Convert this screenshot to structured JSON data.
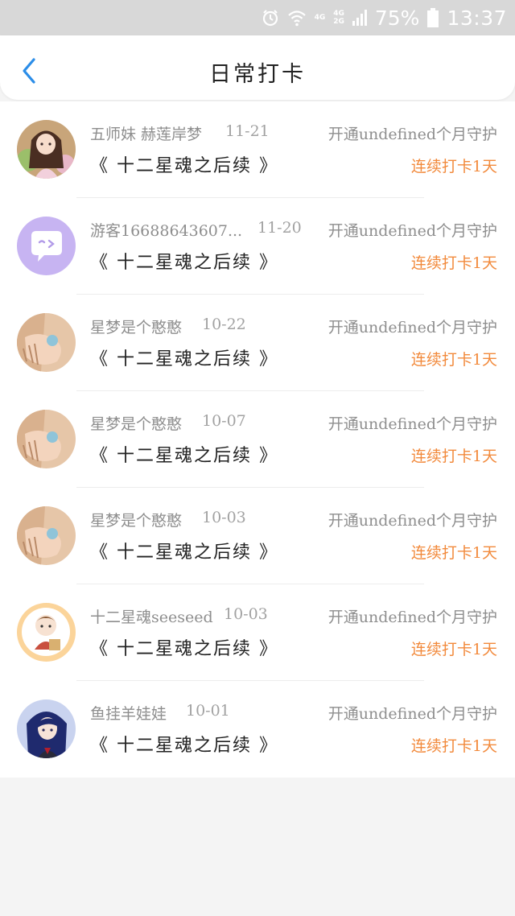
{
  "status_bar": {
    "network_top": "4G",
    "network_dual_top": "4G",
    "network_dual_bottom": "2G",
    "battery_percent": "75%",
    "time": "13:37"
  },
  "header": {
    "title": "日常打卡",
    "back_icon": "chevron-left-icon"
  },
  "colors": {
    "accent_blue": "#2b8de8",
    "streak_orange": "#f28a3c",
    "muted_text": "#8e8e8e"
  },
  "checkins": [
    {
      "username": "五师妹 赫莲岸梦",
      "date": "11-21",
      "book": "《 十二星魂之后续 》",
      "guard": "开通undefined个月守护",
      "streak": "连续打卡1天",
      "avatar": "anime-girl-avatar"
    },
    {
      "username": "游客16688643607...",
      "date": "11-20",
      "book": "《 十二星魂之后续 》",
      "guard": "开通undefined个月守护",
      "streak": "连续打卡1天",
      "avatar": "chat-bubble-avatar"
    },
    {
      "username": "星梦是个憨憨",
      "date": "10-22",
      "book": "《 十二星魂之后续 》",
      "guard": "开通undefined个月守护",
      "streak": "连续打卡1天",
      "avatar": "hand-avatar"
    },
    {
      "username": "星梦是个憨憨",
      "date": "10-07",
      "book": "《 十二星魂之后续 》",
      "guard": "开通undefined个月守护",
      "streak": "连续打卡1天",
      "avatar": "hand-avatar"
    },
    {
      "username": "星梦是个憨憨",
      "date": "10-03",
      "book": "《 十二星魂之后续 》",
      "guard": "开通undefined个月守护",
      "streak": "连续打卡1天",
      "avatar": "hand-avatar"
    },
    {
      "username": "十二星魂seeseed",
      "date": "10-03",
      "book": "《 十二星魂之后续 》",
      "guard": "开通undefined个月守护",
      "streak": "连续打卡1天",
      "avatar": "chibi-avatar"
    },
    {
      "username": "鱼挂羊娃娃",
      "date": "10-01",
      "book": "《 十二星魂之后续 》",
      "guard": "开通undefined个月守护",
      "streak": "连续打卡1天",
      "avatar": "blue-hair-avatar"
    }
  ]
}
